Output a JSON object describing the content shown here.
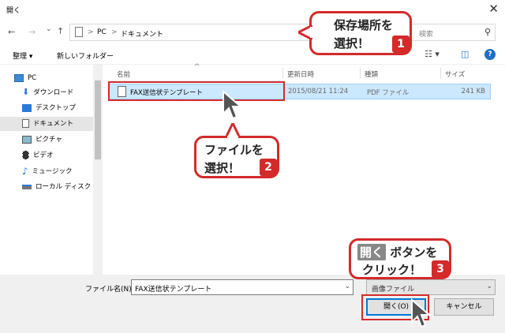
{
  "window": {
    "title": "開く",
    "close_glyph": "✕"
  },
  "nav": {
    "back": "←",
    "forward": "→",
    "recent": "⌄",
    "up": "↑"
  },
  "address": {
    "root": "PC",
    "folder": "ドキュメント",
    "sep": ">"
  },
  "search": {
    "placeholder": "検索",
    "icon": "search-icon"
  },
  "toolbar": {
    "organize": "整理 ▾",
    "new_folder": "新しいフォルダー",
    "view_glyph": "☷ ▾",
    "pane_glyph": "◫",
    "help_glyph": "?"
  },
  "sidebar": {
    "items": [
      {
        "label": "PC",
        "icon": "pc-icon"
      },
      {
        "label": "ダウンロード",
        "icon": "download-icon"
      },
      {
        "label": "デスクトップ",
        "icon": "desktop-icon"
      },
      {
        "label": "ドキュメント",
        "icon": "documents-icon"
      },
      {
        "label": "ピクチャ",
        "icon": "pictures-icon"
      },
      {
        "label": "ビデオ",
        "icon": "video-icon"
      },
      {
        "label": "ミュージック",
        "icon": "music-icon"
      },
      {
        "label": "ローカル ディスク (C",
        "icon": "disk-icon"
      }
    ]
  },
  "columns": {
    "name": "名前",
    "date": "更新日時",
    "type": "種類",
    "size": "サイズ"
  },
  "files": [
    {
      "name": "FAX送信状テンプレート",
      "date": "2015/08/21 11:24",
      "type": "PDF ファイル",
      "size": "241 KB"
    }
  ],
  "footer": {
    "filename_label": "ファイル名(N):",
    "filename_value": "FAX送信状テンプレート",
    "filetype_value": "画像ファイル",
    "open_label": "開く(O)",
    "cancel_label": "キャンセル"
  },
  "callouts": {
    "c1": {
      "line1": "保存場所を",
      "line2": "選択！",
      "num": "1"
    },
    "c2": {
      "line1": "ファイルを",
      "line2": "選択！",
      "num": "2"
    },
    "c3": {
      "chip": "開く",
      "line1_rest": "ボタンを",
      "line2": "クリック！",
      "num": "3"
    }
  },
  "colors": {
    "accent": "#d42a2a",
    "selection": "#cce8ff",
    "focus": "#0078d7"
  }
}
